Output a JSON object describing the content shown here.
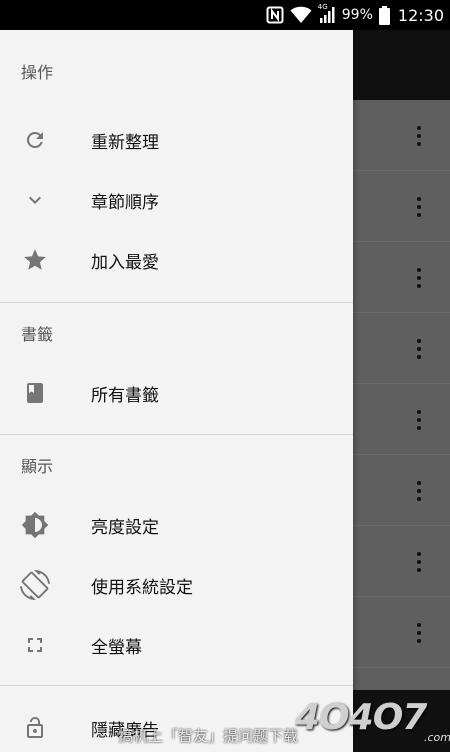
{
  "status_bar": {
    "network": "4G",
    "battery": "99%",
    "time": "12:30"
  },
  "drawer": {
    "sections": [
      {
        "header": "操作",
        "items": [
          {
            "label": "重新整理",
            "icon": "refresh-icon"
          },
          {
            "label": "章節順序",
            "icon": "chevron-down-icon"
          },
          {
            "label": "加入最愛",
            "icon": "star-icon"
          }
        ]
      },
      {
        "header": "書籤",
        "items": [
          {
            "label": "所有書籤",
            "icon": "bookmark-icon"
          }
        ]
      },
      {
        "header": "顯示",
        "items": [
          {
            "label": "亮度設定",
            "icon": "brightness-icon"
          },
          {
            "label": "使用系統設定",
            "icon": "screen-rotation-icon"
          },
          {
            "label": "全螢幕",
            "icon": "fullscreen-icon"
          }
        ]
      },
      {
        "header": "",
        "items": [
          {
            "label": "隱藏廣告",
            "icon": "lock-open-icon"
          }
        ]
      }
    ]
  },
  "watermark": {
    "caption": "搞机上「智友」提问题下载",
    "logo": "4O4O7",
    "domain": ".com"
  },
  "colors": {
    "drawer_bg": "#f3f3f3",
    "scrim": "#5f5f5f",
    "toolbar": "#101010",
    "icon": "#757575"
  }
}
